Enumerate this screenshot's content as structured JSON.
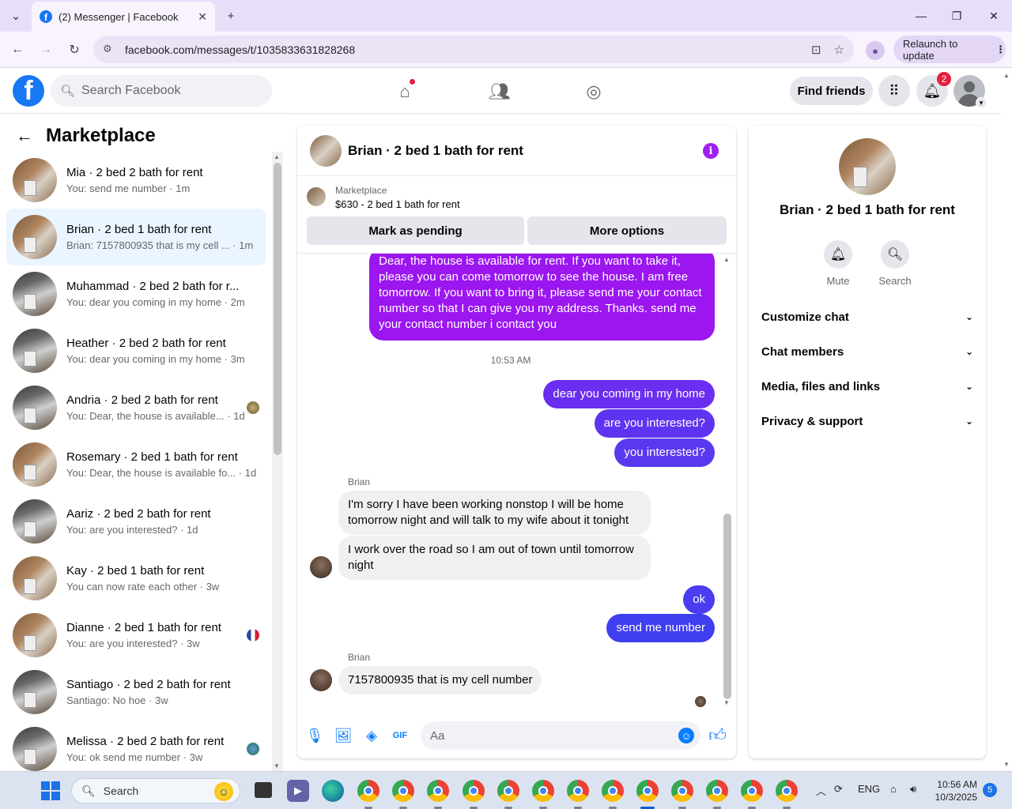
{
  "browser": {
    "tab_title": "(2) Messenger | Facebook",
    "url": "facebook.com/messages/t/1035833631828268",
    "relaunch_label": "Relaunch to update"
  },
  "fb": {
    "search_placeholder": "Search Facebook",
    "find_friends": "Find friends",
    "notif_count": "2"
  },
  "sidebar": {
    "title": "Marketplace",
    "conversations": [
      {
        "name": "Mia · 2 bed 2 bath for rent",
        "preview": "You: send me number · 1m",
        "thumb": "k1"
      },
      {
        "name": "Brian · 2 bed 1 bath for rent",
        "preview": "Brian: 7157800935 that is my cell ... · 1m",
        "thumb": "k1",
        "active": true
      },
      {
        "name": "Muhammad · 2 bed 2 bath for r...",
        "preview": "You: dear you coming in my home · 2m",
        "thumb": "k2"
      },
      {
        "name": "Heather · 2 bed 2 bath for rent",
        "preview": "You: dear you coming in my home · 3m",
        "thumb": "k2"
      },
      {
        "name": "Andria · 2 bed 2 bath for rent",
        "preview": "You: Dear, the house is available... · 1d",
        "thumb": "k2",
        "seen": "ph"
      },
      {
        "name": "Rosemary · 2 bed 1 bath for rent",
        "preview": "You: Dear, the house is available fo... · 1d",
        "thumb": "k1"
      },
      {
        "name": "Aariz · 2 bed 2 bath for rent",
        "preview": "You: are you interested? · 1d",
        "thumb": "k2"
      },
      {
        "name": "Kay · 2 bed 1 bath for rent",
        "preview": "You can now rate each other · 3w",
        "thumb": "k1"
      },
      {
        "name": "Dianne · 2 bed 1 bath for rent",
        "preview": "You: are you interested? · 3w",
        "thumb": "k1",
        "seen": "fr"
      },
      {
        "name": "Santiago · 2 bed 2 bath for rent",
        "preview": "Santiago: No hoe · 3w",
        "thumb": "k2"
      },
      {
        "name": "Melissa · 2 bed 2 bath for rent",
        "preview": "You: ok send me number · 3w",
        "thumb": "k2",
        "seen": "gl"
      }
    ]
  },
  "chat": {
    "title": "Brian · 2 bed 1 bath for rent",
    "marketplace_label": "Marketplace",
    "listing": "$630 - 2 bed 1 bath for rent",
    "mark_pending": "Mark as pending",
    "more_options": "More options",
    "messages": {
      "m1": "Dear, the house is available for rent. If you want to take it, please you can come tomorrow to see the house. I am free tomorrow. If you want to bring it, please send me your contact number so that I can give you my address. Thanks. send me your contact number   i contact you",
      "time": "10:53 AM",
      "m2": "dear you coming in my home",
      "m3": "are you interested?",
      "m4": "you interested?",
      "sender1": "Brian",
      "m5": "I'm sorry I have been working nonstop I will be home tomorrow night and will talk to my wife about it tonight",
      "m6": "I work over the road so I am out of town until tomorrow night",
      "m7": "ok",
      "m8": "send me number",
      "sender2": "Brian",
      "m9": "7157800935 that is my cell number"
    },
    "composer_placeholder": "Aa"
  },
  "right_panel": {
    "name": "Brian · 2 bed 1 bath for rent",
    "mute": "Mute",
    "search": "Search",
    "sections": [
      "Customize chat",
      "Chat members",
      "Media, files and links",
      "Privacy & support"
    ]
  },
  "taskbar": {
    "search": "Search",
    "lang": "ENG",
    "time": "10:56 AM",
    "date": "10/3/2025",
    "notif": "5"
  },
  "colors": {
    "accent": "#0a7cff",
    "bubble_purple": "#a020f0",
    "bubble_blue": "#4a3cf0"
  }
}
